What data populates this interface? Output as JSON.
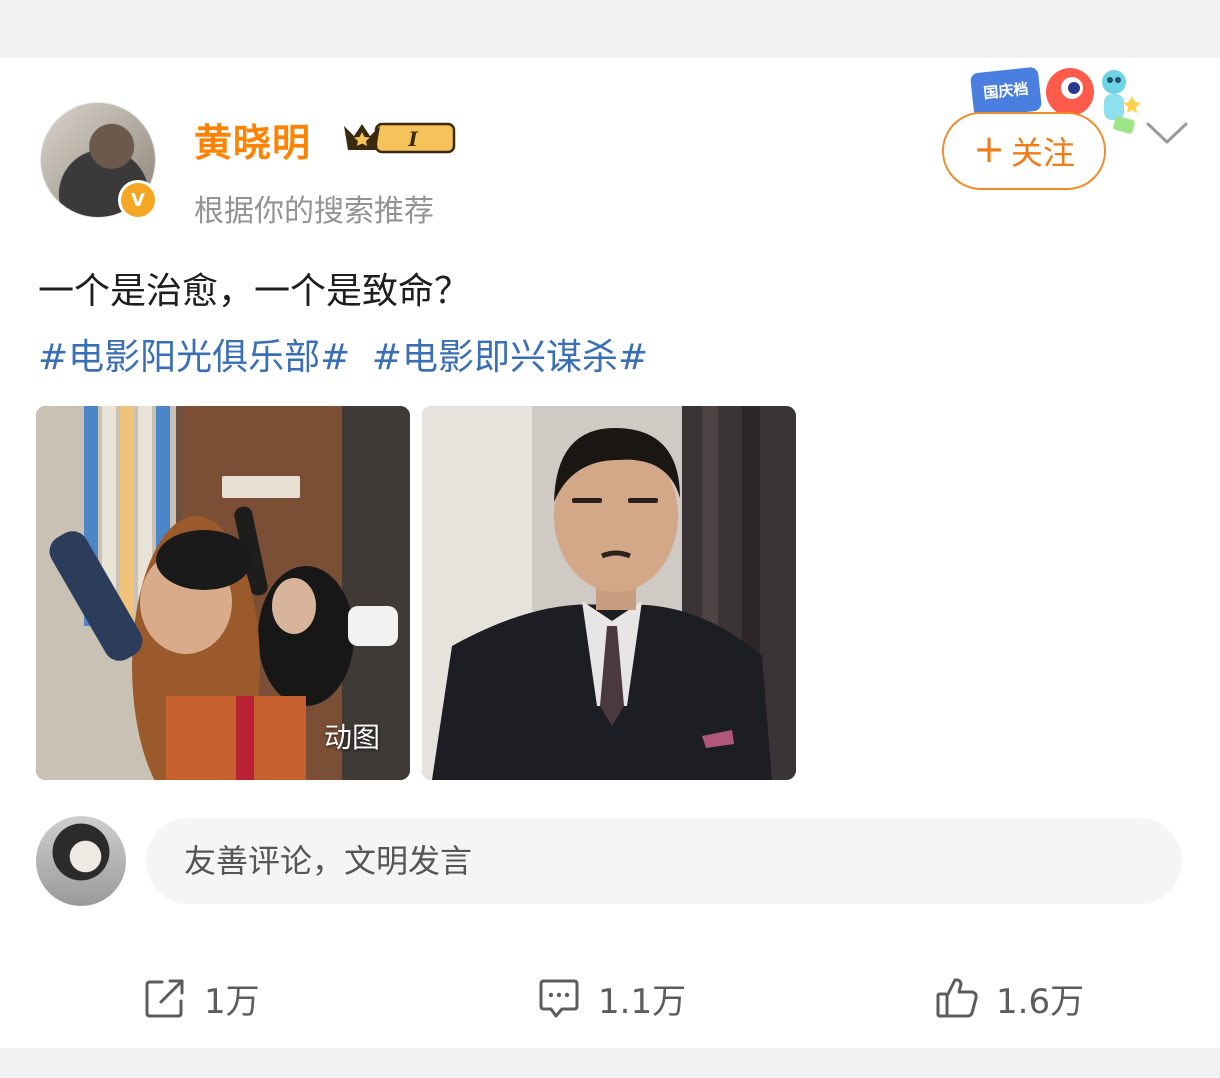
{
  "post": {
    "author": {
      "name": "黄晓明",
      "verified_letter": "V",
      "vip_level": "I",
      "recommend_note": "根据你的搜索推荐",
      "avatar_icon": "user-avatar-photo"
    },
    "follow_button": {
      "plus": "+",
      "label": "关注"
    },
    "festival_sticker_text": "国庆档",
    "text": "一个是治愈，一个是致命？",
    "hashtags": [
      "#电影阳光俱乐部#",
      "#电影即兴谋杀#"
    ],
    "media": [
      {
        "badge": "动图",
        "icon": "gif-image"
      },
      {
        "badge": "",
        "icon": "photo-image"
      }
    ]
  },
  "comment_box": {
    "placeholder": "友善评论，文明发言"
  },
  "actions": {
    "repost": {
      "count": "1万",
      "icon": "share-icon"
    },
    "comment": {
      "count": "1.1万",
      "icon": "comment-icon"
    },
    "like": {
      "count": "1.6万",
      "icon": "thumbs-up-icon"
    }
  },
  "colors": {
    "username": "#ff8200",
    "hashtag": "#3a6fb5",
    "follow_border": "#f08a2a",
    "muted_text": "#939393"
  }
}
